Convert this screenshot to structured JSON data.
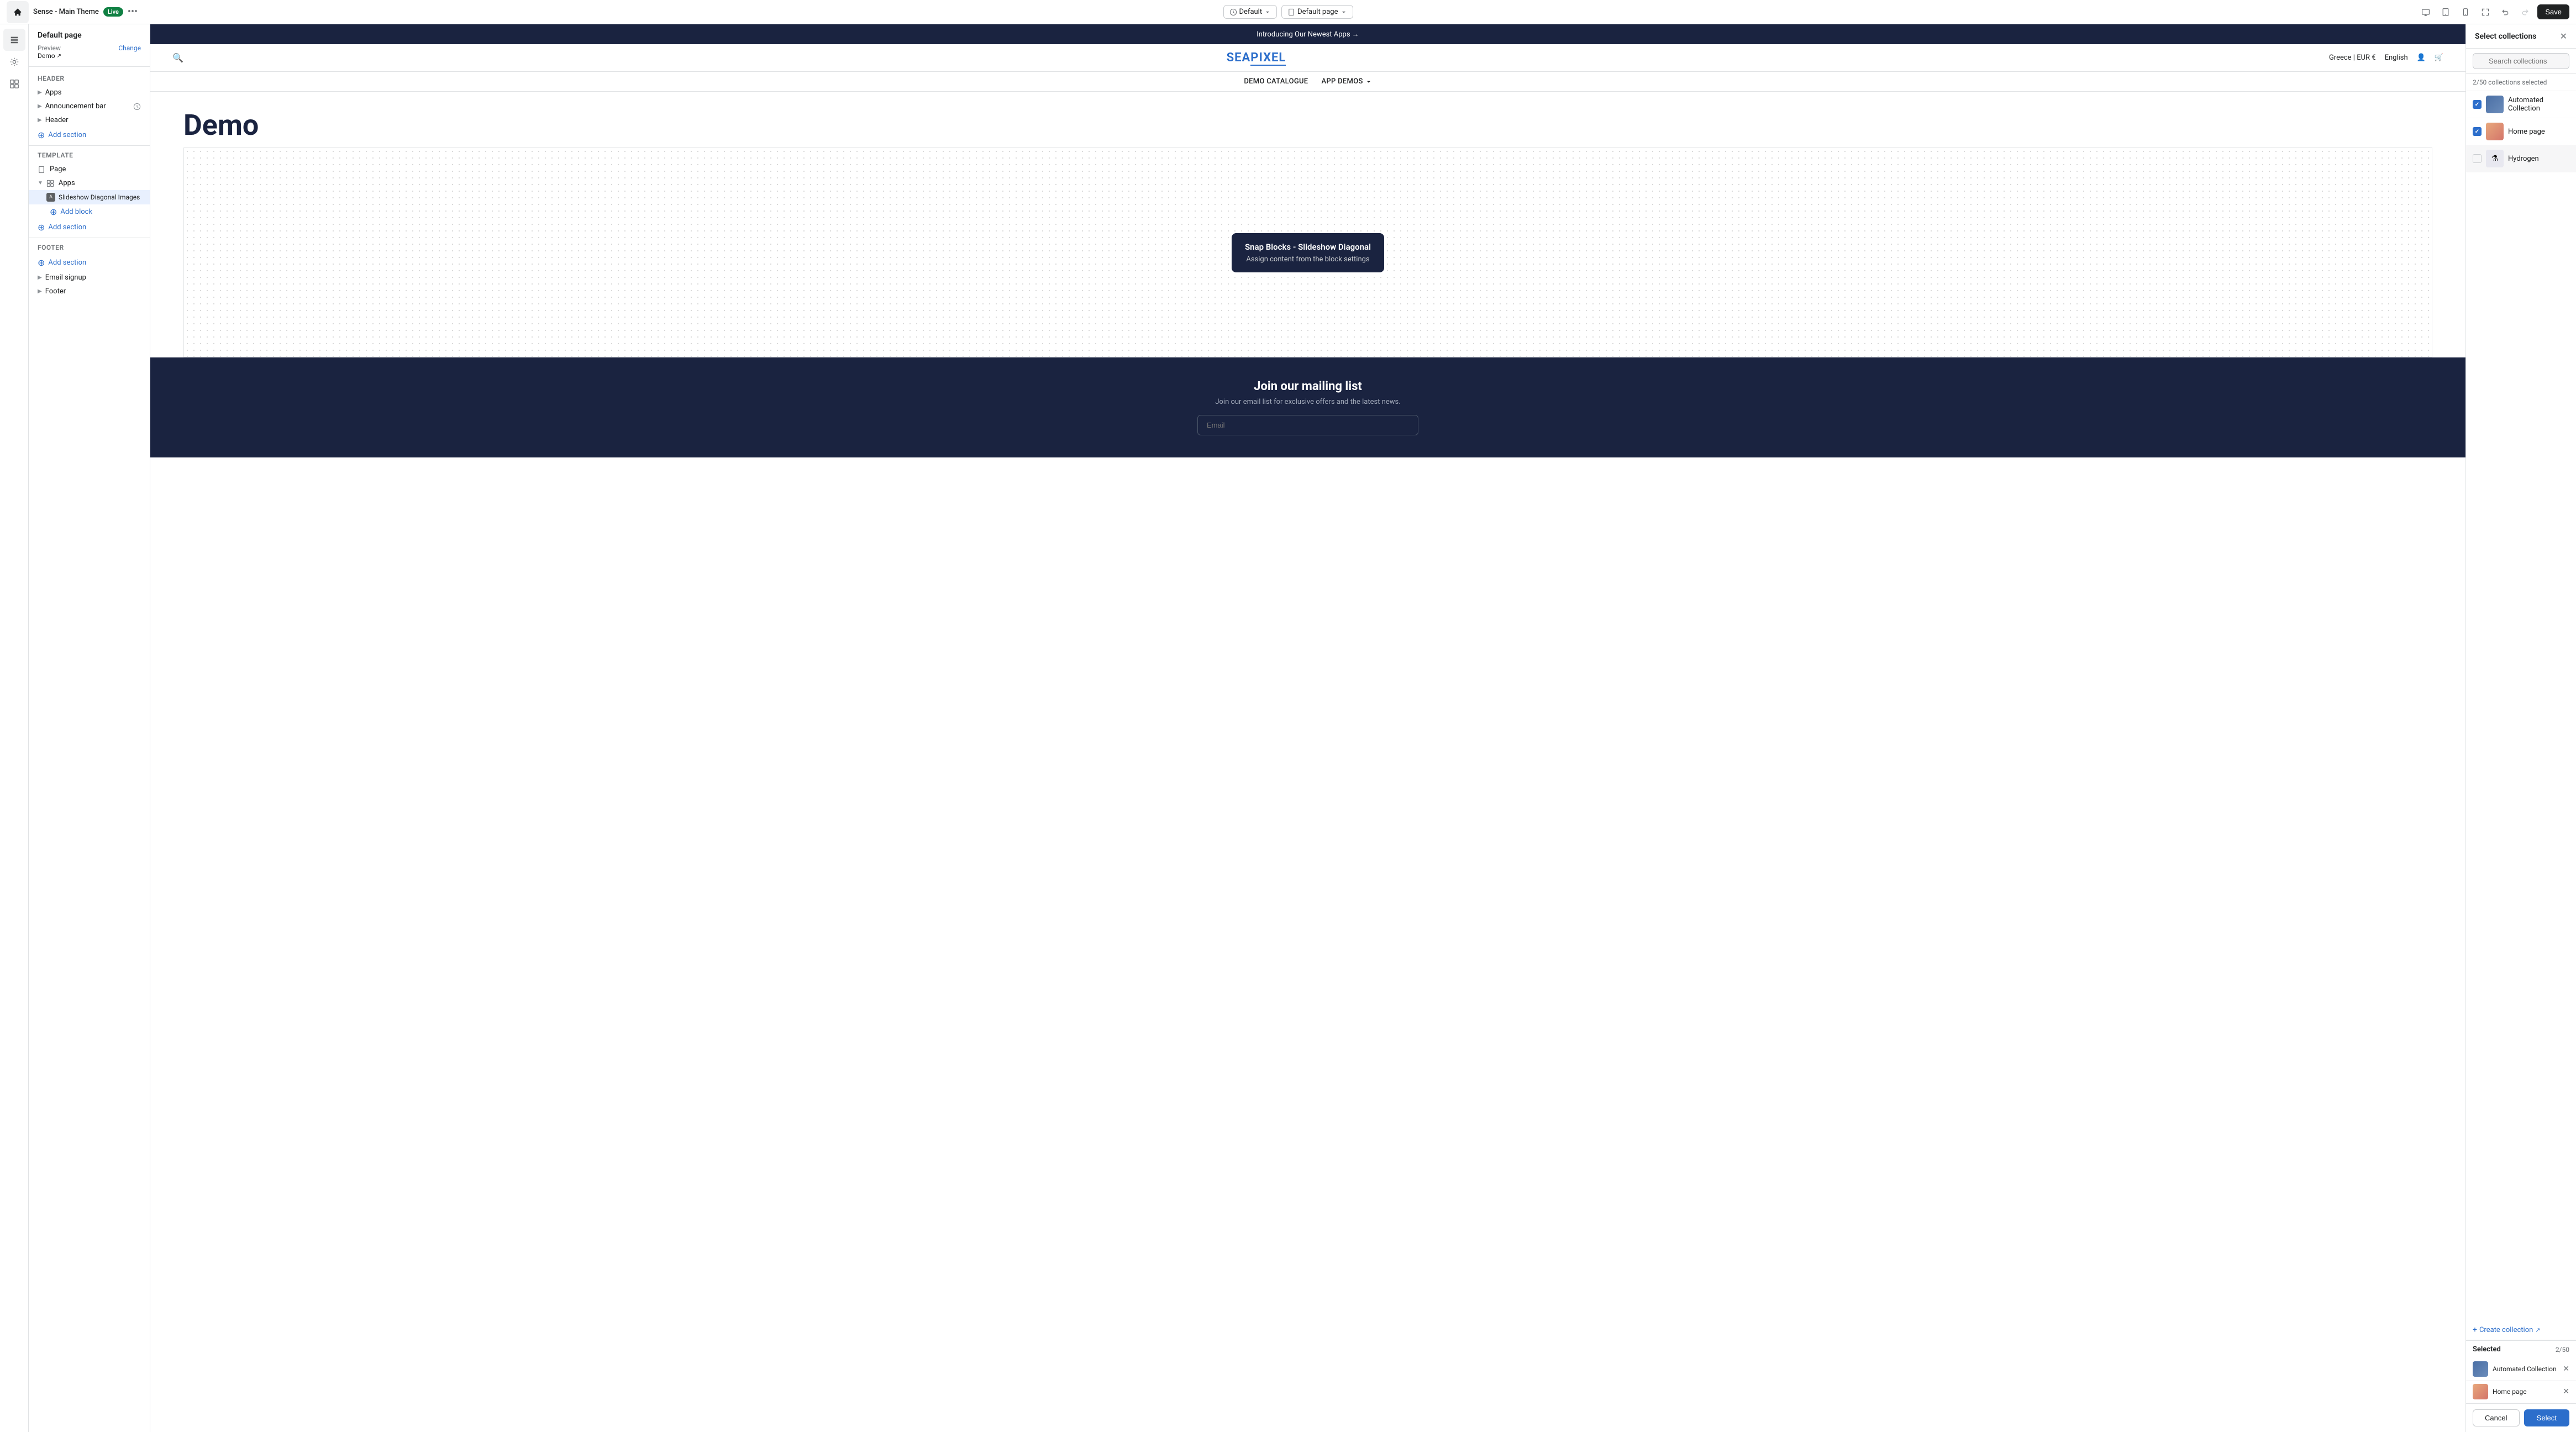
{
  "topbar": {
    "theme_name": "Sense - Main Theme",
    "live_label": "Live",
    "dots_label": "•••",
    "default_label": "Default",
    "default_page_label": "Default page",
    "save_label": "Save"
  },
  "left_sidebar": {
    "page_title": "Default page",
    "preview_label": "Preview",
    "change_label": "Change",
    "demo_label": "Demo",
    "header_section": "Header",
    "apps_label": "Apps",
    "announcement_bar_label": "Announcement bar",
    "header_label": "Header",
    "add_section_label": "Add section",
    "template_section": "Template",
    "page_label": "Page",
    "apps_template_label": "Apps",
    "slideshow_diagonal_label": "Slideshow Diagonal Images",
    "add_block_label": "Add block",
    "footer_section": "Footer",
    "add_section_footer_label": "Add section",
    "email_signup_label": "Email signup",
    "footer_label": "Footer"
  },
  "canvas": {
    "announcement_text": "Introducing Our Newest Apps →",
    "store_name_1": "SEA",
    "store_name_2": "PIXEL",
    "region_label": "Greece | EUR €",
    "language_label": "English",
    "nav_items": [
      "DEMO CATALOGUE",
      "APP DEMOS"
    ],
    "demo_heading": "Demo",
    "snap_tooltip_title": "Snap Blocks - Slideshow Diagonal",
    "snap_tooltip_sub": "Assign content from the block settings",
    "footer_title": "Join our mailing list",
    "footer_subtitle": "Join our email list for exclusive offers and the latest news.",
    "email_placeholder": "Email"
  },
  "right_panel": {
    "title": "Select collections",
    "search_placeholder": "Search collections",
    "collections_count": "2/50 collections selected",
    "collections": [
      {
        "name": "Automated Collection",
        "checked": true,
        "thumb_type": "auto"
      },
      {
        "name": "Home page",
        "checked": true,
        "thumb_type": "home"
      },
      {
        "name": "Hydrogen",
        "checked": false,
        "thumb_type": "hydrogen"
      }
    ],
    "create_collection_label": "Create collection",
    "selected_title": "Selected",
    "selected_count": "2/50",
    "selected_items": [
      {
        "name": "Automated Collection",
        "thumb_type": "auto"
      },
      {
        "name": "Home page",
        "thumb_type": "home"
      }
    ],
    "cancel_label": "Cancel",
    "select_label": "Select"
  }
}
